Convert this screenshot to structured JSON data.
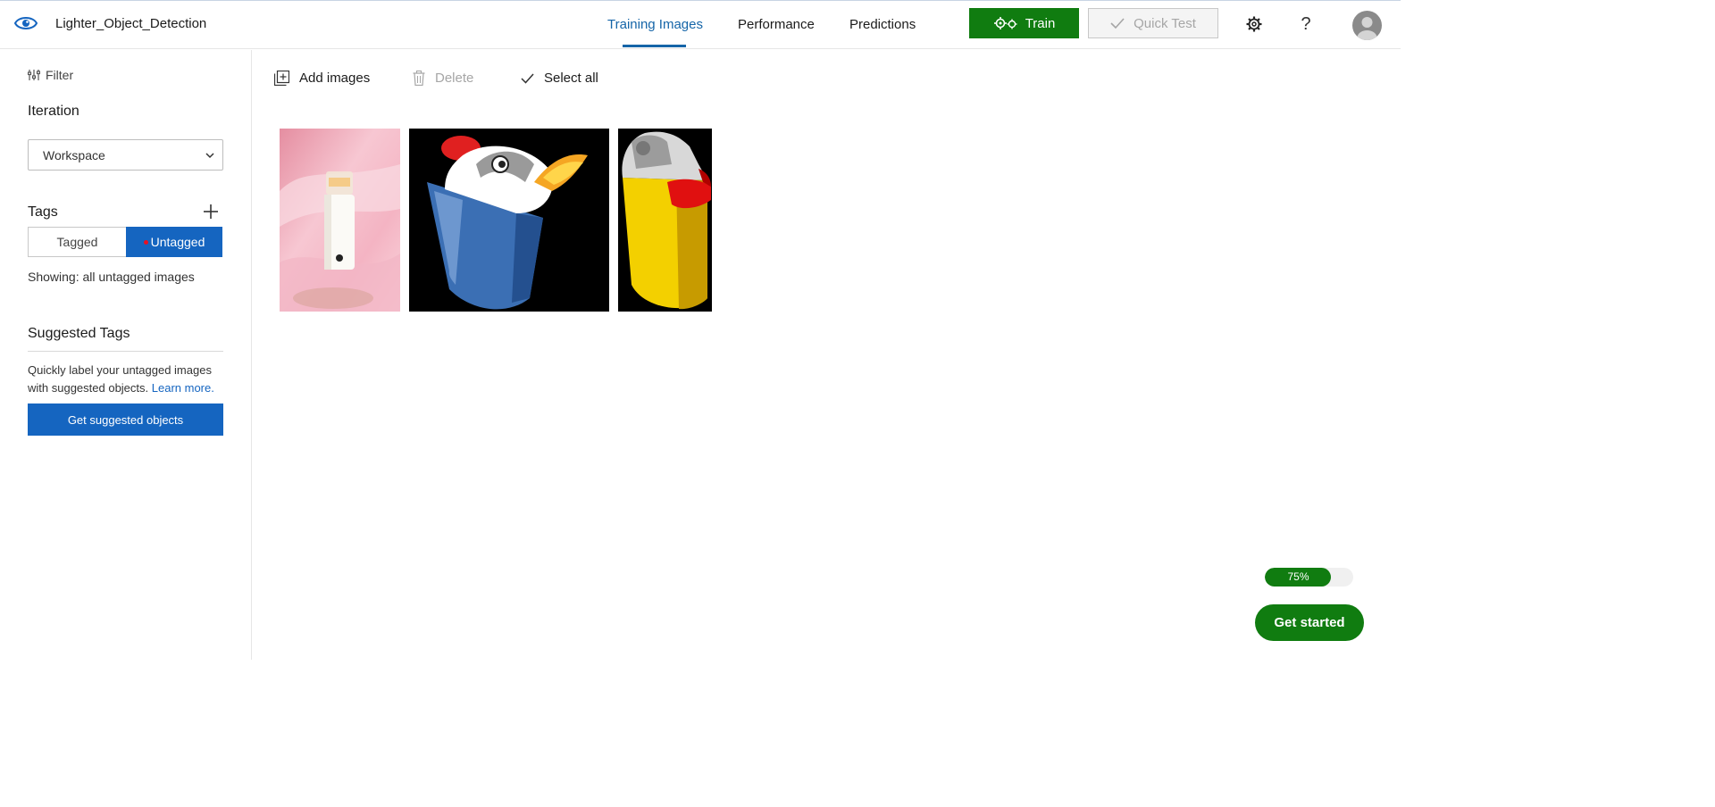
{
  "header": {
    "project_name": "Lighter_Object_Detection",
    "tabs": [
      {
        "label": "Training Images"
      },
      {
        "label": "Performance"
      },
      {
        "label": "Predictions"
      }
    ],
    "train_label": "Train",
    "quick_test_label": "Quick Test",
    "help_label": "?"
  },
  "sidebar": {
    "filter_label": "Filter",
    "iteration_title": "Iteration",
    "iteration_value": "Workspace",
    "tags_title": "Tags",
    "tagged_label": "Tagged",
    "untagged_label": "Untagged",
    "showing_text": "Showing: all untagged images",
    "suggested_title": "Suggested Tags",
    "suggested_desc": "Quickly label your untagged images with suggested objects.",
    "learn_more": "Learn more.",
    "suggest_button": "Get suggested objects"
  },
  "toolbar": {
    "add_images": "Add images",
    "delete": "Delete",
    "select_all": "Select all"
  },
  "images": [
    {
      "subject": "lighter on pink fabric"
    },
    {
      "subject": "cartoon blue lighter"
    },
    {
      "subject": "cartoon yellow lighter"
    }
  ],
  "progress": {
    "value": 0.75,
    "label": "75%"
  },
  "get_started": "Get started",
  "colors": {
    "accent": "#1565c0",
    "train_green": "#107c10",
    "tab_blue": "#1565a8"
  }
}
